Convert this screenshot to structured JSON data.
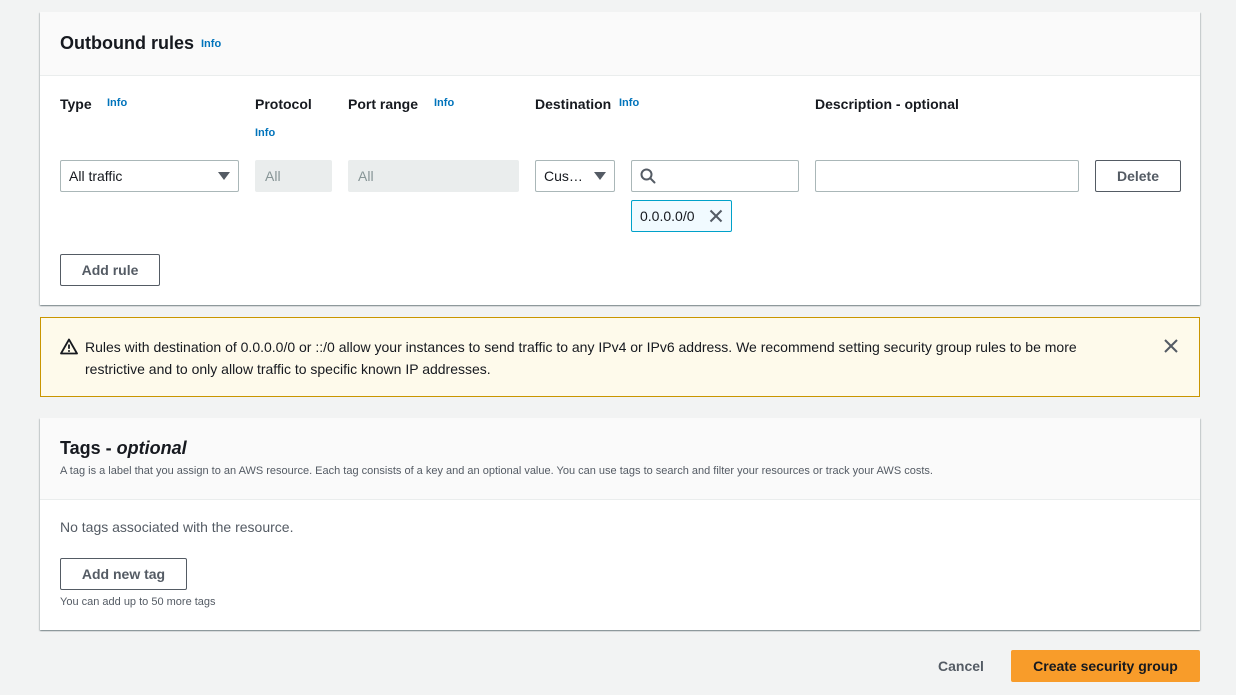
{
  "outbound": {
    "title": "Outbound rules",
    "info": "Info",
    "columns": {
      "type": "Type",
      "type_info": "Info",
      "protocol": "Protocol",
      "protocol_info": "Info",
      "port_range": "Port range",
      "port_range_info": "Info",
      "destination": "Destination",
      "destination_info": "Info",
      "description": "Description - optional"
    },
    "rule": {
      "type_value": "All traffic",
      "protocol_value": "All",
      "port_range_value": "All",
      "destination_select": "Cus…",
      "destination_search": "",
      "destination_token": "0.0.0.0/0",
      "description_value": "",
      "delete_label": "Delete"
    },
    "add_rule_label": "Add rule"
  },
  "alert": {
    "message": "Rules with destination of 0.0.0.0/0 or ::/0 allow your instances to send traffic to any IPv4 or IPv6 address. We recommend setting security group rules to be more restrictive and to only allow traffic to specific known IP addresses."
  },
  "tags": {
    "title_main": "Tags - ",
    "title_optional": "optional",
    "description": "A tag is a label that you assign to an AWS resource. Each tag consists of a key and an optional value. You can use tags to search and filter your resources or track your AWS costs.",
    "empty_text": "No tags associated with the resource.",
    "add_label": "Add new tag",
    "limit_text": "You can add up to 50 more tags"
  },
  "footer": {
    "cancel_label": "Cancel",
    "create_label": "Create security group"
  },
  "icons": {
    "caret": "caret-down-icon",
    "search": "search-icon",
    "dismiss": "close-icon",
    "warning": "warning-icon"
  },
  "colors": {
    "link": "#0073bb",
    "primary": "#ec7211",
    "alert_bg": "#fefaeb",
    "token_border": "#00a1c9"
  }
}
